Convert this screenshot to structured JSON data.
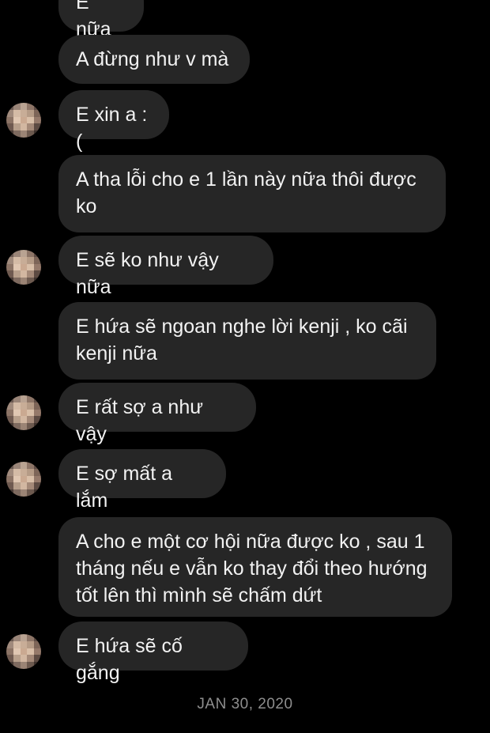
{
  "thread": {
    "messages": [
      {
        "text": "E nữa"
      },
      {
        "text": "A đừng như v mà"
      },
      {
        "text": "E xin a :("
      },
      {
        "text": "A tha lỗi cho e 1 lần này nữa thôi được ko"
      },
      {
        "text": "E sẽ ko như vậy nữa"
      },
      {
        "text": "E hứa sẽ ngoan nghe lời kenji , ko cãi kenji nữa"
      },
      {
        "text": "E rất sợ a như vậy"
      },
      {
        "text": "E sợ mất a lắm"
      },
      {
        "text": "A cho e một cơ hội nữa được ko , sau 1 tháng nếu e vẫn ko thay đổi theo hướng tốt lên thì mình sẽ chấm dứt"
      },
      {
        "text": "E hứa sẽ cố gắng"
      }
    ],
    "date_separator": "JAN 30, 2020"
  },
  "theme": {
    "background": "#000000",
    "bubble_color": "#262626",
    "text_color": "#f2f2f2",
    "date_color": "#8e8e8e",
    "avatar_icon": "pixelated-avatar-icon"
  }
}
